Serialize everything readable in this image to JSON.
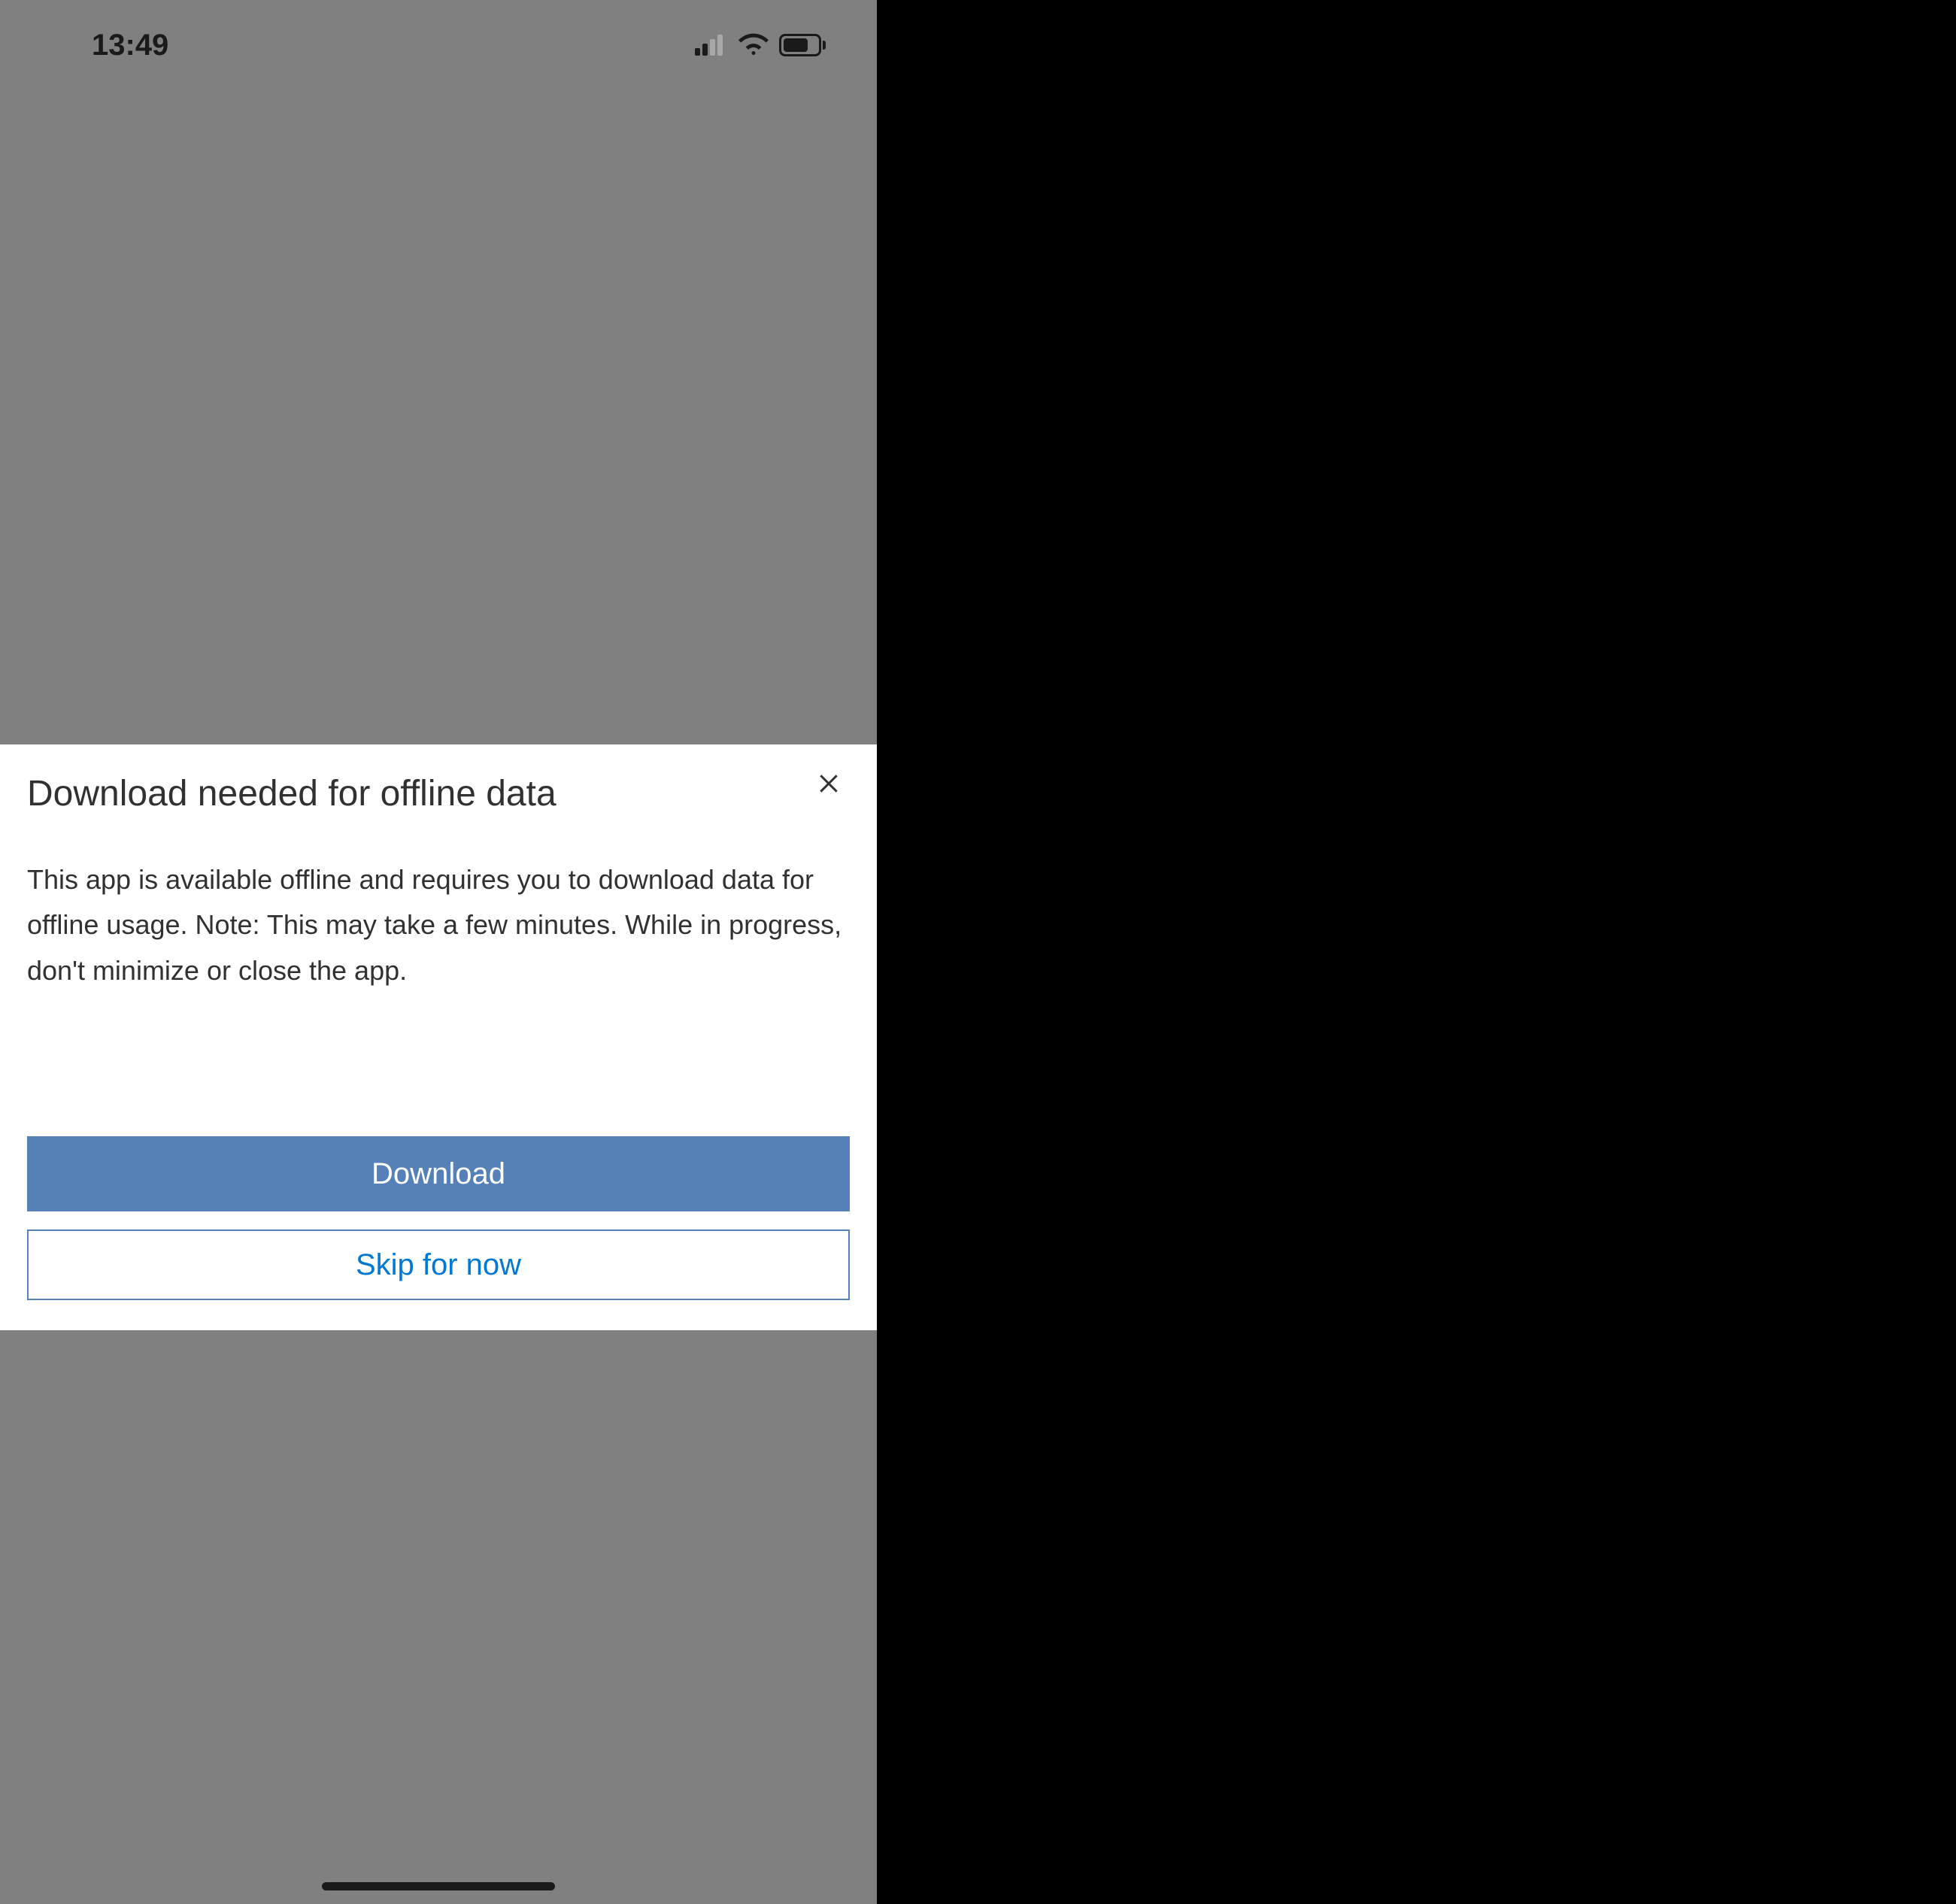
{
  "status_bar": {
    "time": "13:49"
  },
  "dialog": {
    "title": "Download needed for offline data",
    "body": "This app is available offline and requires you to download data for offline usage. Note: This may take a few minutes. While in progress, don't minimize or close the app.",
    "primary_button": "Download",
    "secondary_button": "Skip for now"
  }
}
